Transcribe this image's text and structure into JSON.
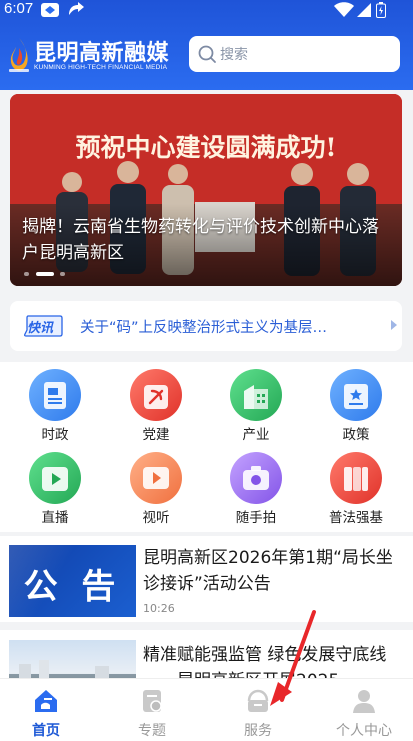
{
  "status_bar": {
    "time": "6:07"
  },
  "header": {
    "logo_name": "昆明高新融媒",
    "logo_sub": "KUNMING HIGH-TECH FINANCIAL MEDIA",
    "search_placeholder": "搜索"
  },
  "banner": {
    "sign_text": "预祝中心建设圆满成功!",
    "caption": "揭牌！云南省生物药转化与评价技术创新中心落户昆明高新区",
    "slide_count": 3,
    "active_slide": 1
  },
  "news_flash": {
    "badge": "快讯",
    "text": "关于“码”上反映整治形式主义为基层…"
  },
  "categories": [
    {
      "label": "时政",
      "icon": "document-icon",
      "color": "#3d8bf0"
    },
    {
      "label": "党建",
      "icon": "party-emblem-icon",
      "color": "#e8433a"
    },
    {
      "label": "产业",
      "icon": "building-icon",
      "color": "#2fbf6a"
    },
    {
      "label": "政策",
      "icon": "policy-badge-icon",
      "color": "#3d8bf0"
    },
    {
      "label": "直播",
      "icon": "live-play-icon",
      "color": "#2fbf6a"
    },
    {
      "label": "视听",
      "icon": "video-play-icon",
      "color": "#f58a5a"
    },
    {
      "label": "随手拍",
      "icon": "camera-icon",
      "color": "#9a6cf0"
    },
    {
      "label": "普法强基",
      "icon": "law-book-icon",
      "color": "#e8433a"
    }
  ],
  "feed": [
    {
      "thumb_text": "公 告",
      "title": "昆明高新区2026年第1期“局长坐诊接诉”活动公告",
      "time": "10:26"
    },
    {
      "title": "精准赋能强监管  绿色发展守底线——昆明高新区开展2025"
    }
  ],
  "tabs": [
    {
      "label": "首页",
      "icon": "home-icon",
      "active": true
    },
    {
      "label": "专题",
      "icon": "topic-icon",
      "active": false
    },
    {
      "label": "服务",
      "icon": "service-icon",
      "active": false
    },
    {
      "label": "个人中心",
      "icon": "user-icon",
      "active": false
    }
  ],
  "colors": {
    "brand": "#1f54d8",
    "accent_blue": "#2864e6",
    "red": "#e8433a"
  }
}
